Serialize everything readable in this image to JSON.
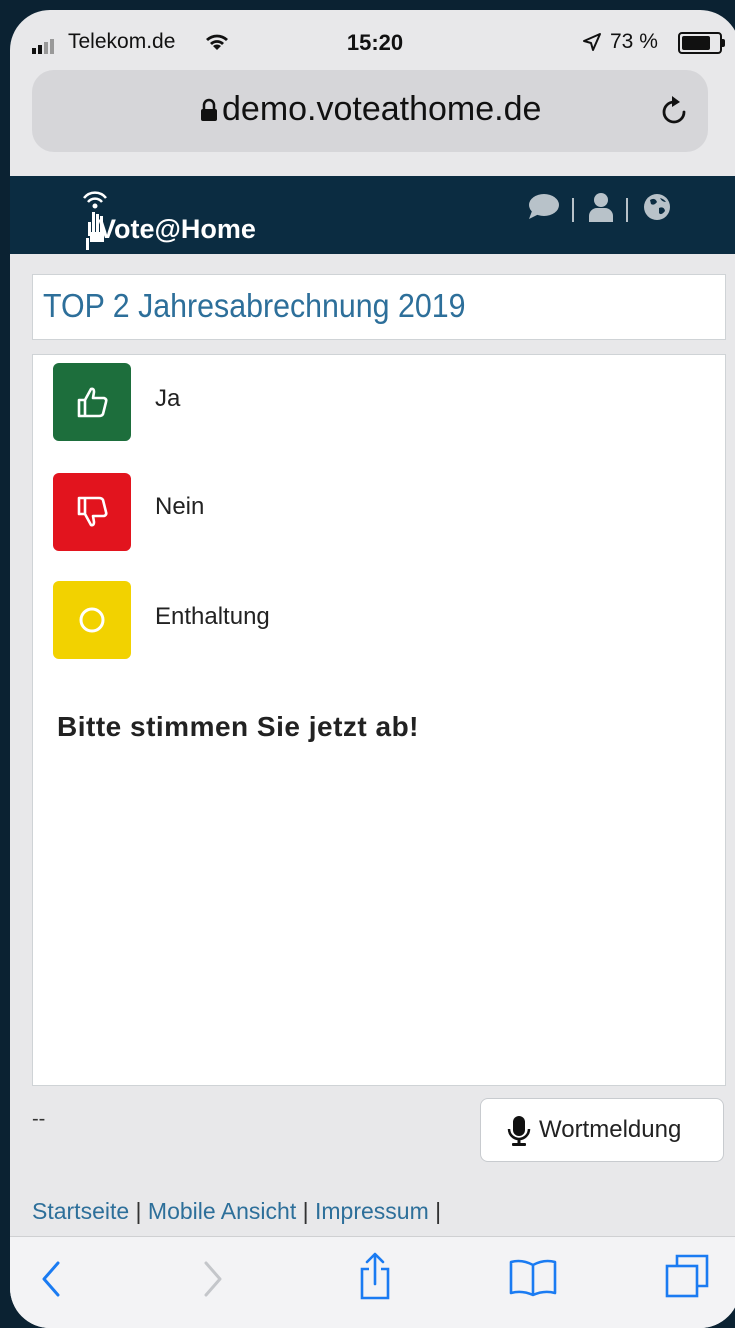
{
  "status_bar": {
    "carrier": "Telekom.de",
    "time": "15:20",
    "battery": "73 %"
  },
  "browser": {
    "url": "demo.voteathome.de"
  },
  "header": {
    "logo_text": "Vote@Home",
    "icons": [
      "chat-icon",
      "user-icon",
      "globe-icon"
    ]
  },
  "topic": {
    "title": "TOP 2 Jahresabrechnung 2019"
  },
  "vote_options": [
    {
      "label": "Ja",
      "color": "#1d6e3c",
      "icon": "thumbs-up-icon"
    },
    {
      "label": "Nein",
      "color": "#e2141e",
      "icon": "thumbs-down-icon"
    },
    {
      "label": "Enthaltung",
      "color": "#f2d200",
      "icon": "circle-icon"
    }
  ],
  "prompt": "Bitte stimmen Sie jetzt ab!",
  "status_line": "--",
  "speak_button": {
    "label": "Wortmeldung",
    "icon": "microphone-icon"
  },
  "footer": {
    "links": [
      "Startseite",
      "Mobile Ansicht",
      "Impressum"
    ]
  },
  "toolbar": [
    "back-icon",
    "forward-icon",
    "share-icon",
    "bookmarks-icon",
    "tabs-icon"
  ]
}
